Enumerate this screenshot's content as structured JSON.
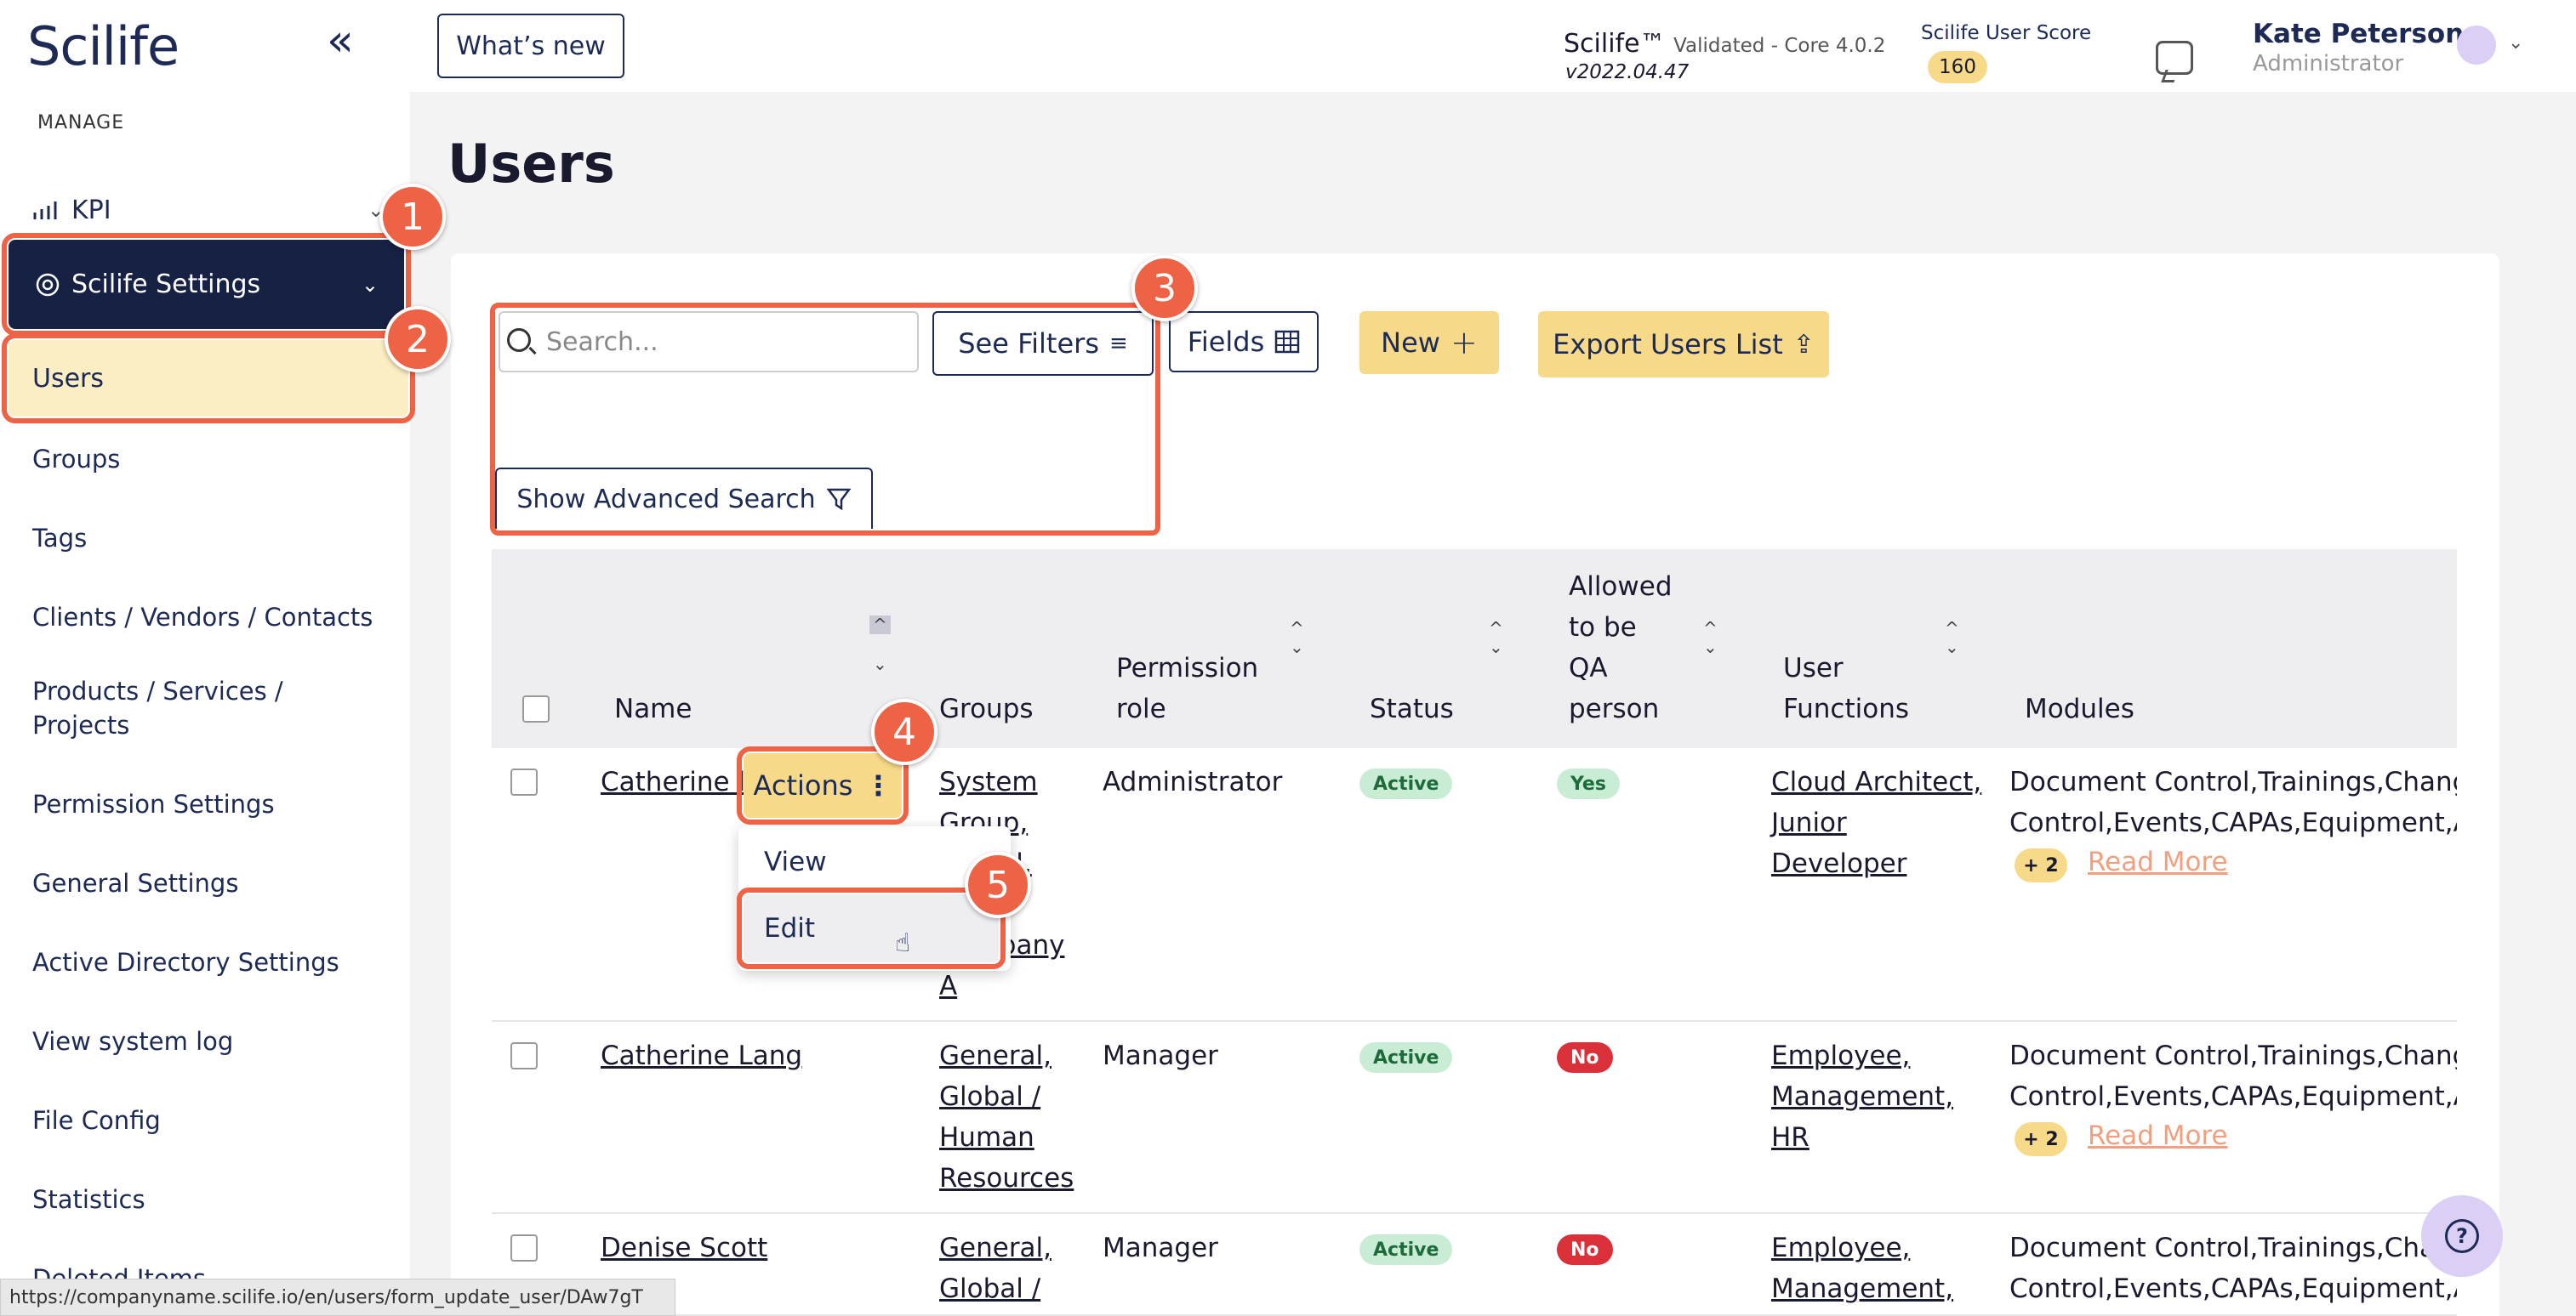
{
  "app": {
    "logo": "Scilife",
    "collapse_icon": "«"
  },
  "sidebar": {
    "section": "MANAGE",
    "kpi": "KPI",
    "settings": "Scilife Settings",
    "items": [
      "Users",
      "Groups",
      "Tags",
      "Clients / Vendors / Contacts",
      "Products / Services /",
      "Projects",
      "Permission Settings",
      "General Settings",
      "Active Directory Settings",
      "View system log",
      "File Config",
      "Statistics",
      "Deleted Items"
    ]
  },
  "header": {
    "whats_new": "What’s new",
    "product": "Scilife™",
    "validated": "Validated - Core 4.0.2",
    "version": "v2022.04.47",
    "score_label": "Scilife User Score",
    "score": "160",
    "user_name": "Kate Peterson",
    "user_role": "Administrator"
  },
  "page": {
    "title": "Users"
  },
  "toolbar": {
    "search_placeholder": "Search...",
    "see_filters": "See Filters",
    "fields": "Fields",
    "new": "New",
    "export": "Export Users List",
    "advanced": "Show Advanced Search"
  },
  "table": {
    "headers": [
      "Name",
      "Groups",
      "Permission",
      "role",
      "Status",
      "Allowed",
      "to be",
      "QA",
      "person",
      "User",
      "Functions",
      "Modules"
    ],
    "rows": [
      {
        "name": "Catherine l",
        "groups": [
          "System",
          "Group,",
          "Global,",
          "A",
          "Company",
          "A"
        ],
        "role": "Administrator",
        "status": "Active",
        "qa": "Yes",
        "functions": [
          "Cloud Architect,",
          "Junior",
          "Developer"
        ],
        "modules1": "Document Control,Trainings,Change",
        "modules2": "Control,Events,CAPAs,Equipment,Au",
        "more": "+ 2",
        "read_more": "Read More"
      },
      {
        "name": "Catherine Lang",
        "groups": [
          "General,",
          "Global /",
          "Human",
          "Resources"
        ],
        "role": "Manager",
        "status": "Active",
        "qa": "No",
        "functions": [
          "Employee,",
          "Management,",
          "HR"
        ],
        "modules1": "Document Control,Trainings,Change",
        "modules2": "Control,Events,CAPAs,Equipment,Au",
        "more": "+ 2",
        "read_more": "Read More"
      },
      {
        "name": "Denise Scott",
        "groups": [
          "General,",
          "Global /"
        ],
        "role": "Manager",
        "status": "Active",
        "qa": "No",
        "functions": [
          "Employee,",
          "Management,"
        ],
        "modules1": "Document Control,Trainings,Change",
        "modules2": "Control,Events,CAPAs,Equipment,Au"
      }
    ]
  },
  "actions_menu": {
    "button": "Actions",
    "view": "View",
    "edit": "Edit"
  },
  "callouts": [
    "1",
    "2",
    "3",
    "4",
    "5"
  ],
  "statusbar": "https://companyname.scilife.io/en/users/form_update_user/DAw7gT",
  "colors": {
    "navy": "#172143",
    "accent": "#ee6245",
    "yellow": "#f7d98a"
  }
}
